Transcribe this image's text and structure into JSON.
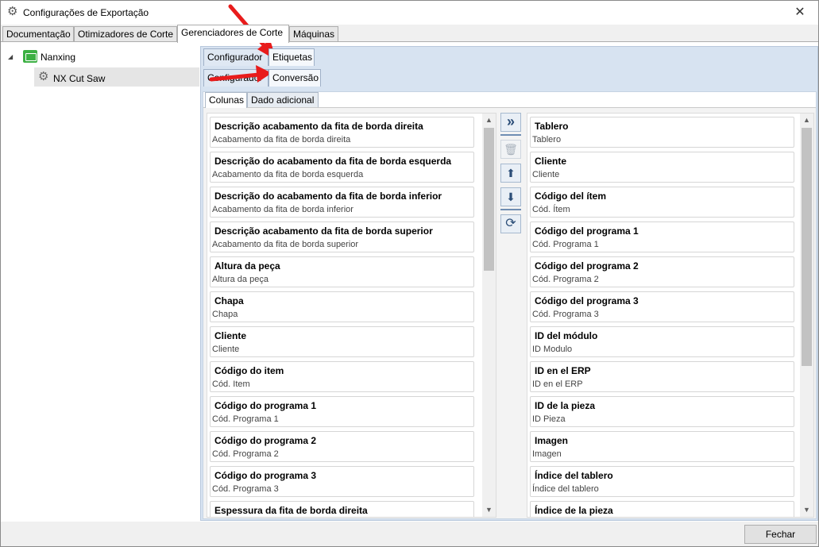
{
  "window": {
    "title": "Configurações de Exportação",
    "close_symbol": "✕"
  },
  "main_tabs": [
    "Documentação",
    "Otimizadores de Corte",
    "Gerenciadores de Corte",
    "Máquinas"
  ],
  "tree": {
    "root": "Nanxing",
    "child": "NX Cut Saw"
  },
  "sub_tabs": [
    "Configurador",
    "Etiquetas"
  ],
  "sub_tabs2": [
    "Configurador",
    "Conversão"
  ],
  "inner_tabs": [
    "Colunas",
    "Dado adicional"
  ],
  "left_list": [
    {
      "title": "Descrição acabamento da fita de borda direita",
      "sub": "Acabamento da fita de borda direita"
    },
    {
      "title": "Descrição do acabamento da fita de borda esquerda",
      "sub": "Acabamento da fita de borda esquerda"
    },
    {
      "title": "Descrição do acabamento da fita de borda inferior",
      "sub": "Acabamento da fita de borda inferior"
    },
    {
      "title": "Descrição acabamento da fita de borda superior",
      "sub": "Acabamento da fita de borda superior"
    },
    {
      "title": "Altura da peça",
      "sub": "Altura da peça"
    },
    {
      "title": "Chapa",
      "sub": "Chapa"
    },
    {
      "title": "Cliente",
      "sub": "Cliente"
    },
    {
      "title": "Código do item",
      "sub": "Cód. Item"
    },
    {
      "title": "Código do programa 1",
      "sub": "Cód. Programa 1"
    },
    {
      "title": "Código do programa 2",
      "sub": "Cód. Programa 2"
    },
    {
      "title": "Código do programa 3",
      "sub": "Cód. Programa 3"
    },
    {
      "title": "Espessura da fita de borda direita",
      "sub": ""
    }
  ],
  "right_list": [
    {
      "title": "Tablero",
      "sub": "Tablero"
    },
    {
      "title": "Cliente",
      "sub": "Cliente"
    },
    {
      "title": "Código del ítem",
      "sub": "Cód. Ítem"
    },
    {
      "title": "Código del programa 1",
      "sub": "Cód. Programa 1"
    },
    {
      "title": "Código del programa 2",
      "sub": "Cód. Programa 2"
    },
    {
      "title": "Código del programa 3",
      "sub": "Cód. Programa 3"
    },
    {
      "title": "ID del módulo",
      "sub": "ID Modulo"
    },
    {
      "title": "ID en el ERP",
      "sub": "ID en el ERP"
    },
    {
      "title": "ID de la pieza",
      "sub": "ID Pieza"
    },
    {
      "title": "Imagen",
      "sub": "Imagen"
    },
    {
      "title": "Índice del tablero",
      "sub": "Índice del tablero"
    },
    {
      "title": "Índice de la pieza",
      "sub": ""
    }
  ],
  "tools": {
    "add": "»",
    "delete": "🗑",
    "up": "⬆",
    "down": "⬇",
    "refresh": "⟳"
  },
  "footer": {
    "close_label": "Fechar"
  },
  "colors": {
    "accent": "#d7e3f1",
    "arrow": "#e81c1c"
  }
}
